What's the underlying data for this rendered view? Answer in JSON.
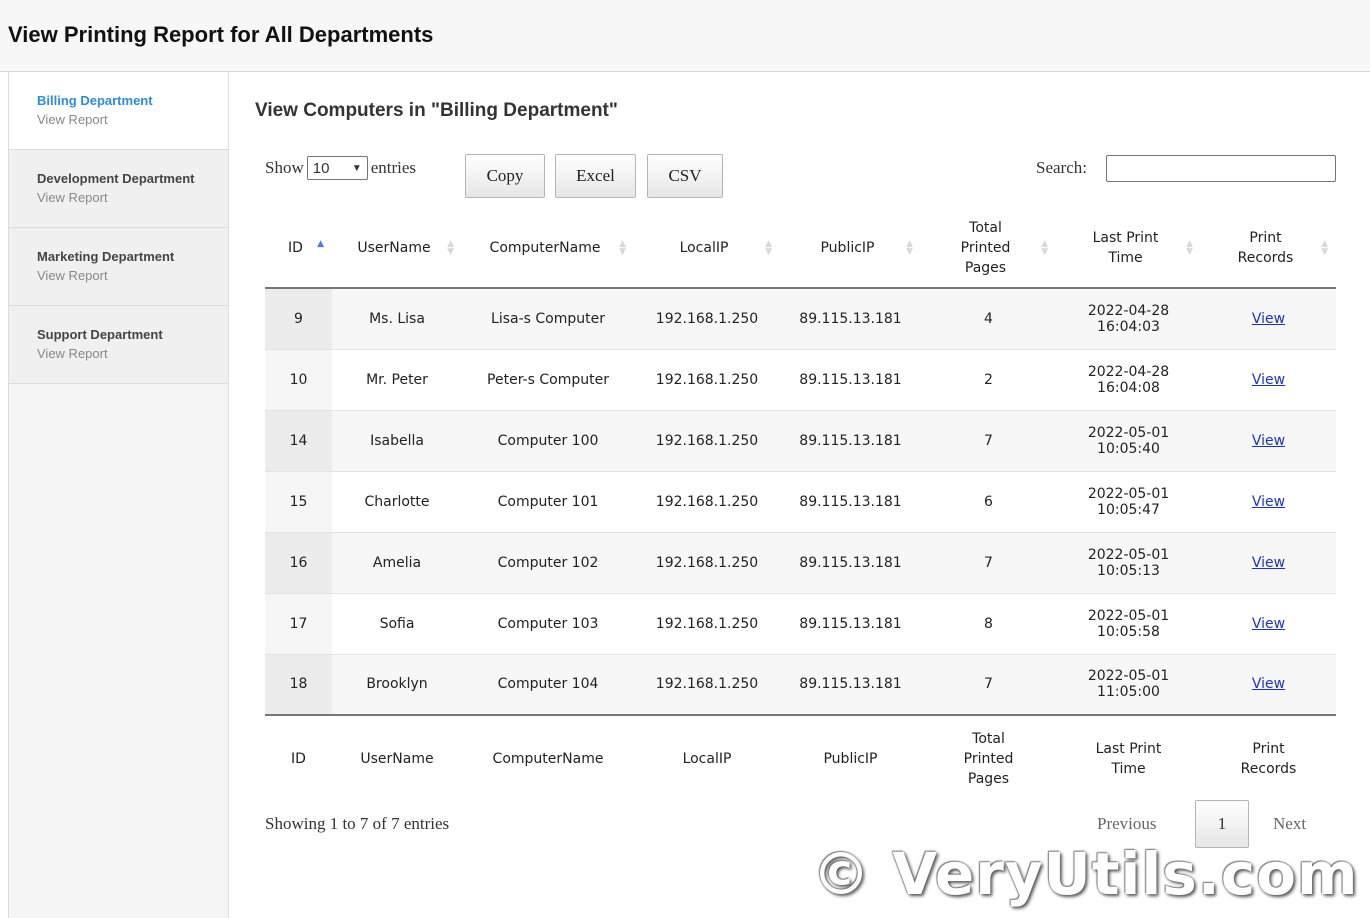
{
  "header": {
    "title": "View Printing Report for All Departments"
  },
  "sidebar": {
    "items": [
      {
        "name": "Billing Department",
        "sub": "View Report",
        "active": true
      },
      {
        "name": "Development Department",
        "sub": "View Report"
      },
      {
        "name": "Marketing Department",
        "sub": "View Report"
      },
      {
        "name": "Support Department",
        "sub": "View Report"
      }
    ]
  },
  "main": {
    "heading": "View Computers in \"Billing Department\"",
    "length": {
      "show": "Show",
      "selected": "10",
      "entries": "entries"
    },
    "buttons": {
      "copy": "Copy",
      "excel": "Excel",
      "csv": "CSV"
    },
    "search": {
      "label": "Search:",
      "value": ""
    }
  },
  "table": {
    "headers": {
      "id": "ID",
      "username": "UserName",
      "computername": "ComputerName",
      "localip": "LocalIP",
      "publicip": "PublicIP",
      "total_line1": "Total",
      "total_line2": "Printed",
      "total_line3": "Pages",
      "last_line1": "Last Print",
      "last_line2": "Time",
      "records_line1": "Print",
      "records_line2": "Records"
    },
    "sorted_column": "ID",
    "sort_direction": "ascending",
    "rows": [
      {
        "id": "9",
        "user": "Ms. Lisa",
        "computer": "Lisa-s Computer",
        "local": "192.168.1.250",
        "public": "89.115.13.181",
        "pages": "4",
        "date": "2022-04-28",
        "time": "16:04:03",
        "link": "View"
      },
      {
        "id": "10",
        "user": "Mr. Peter",
        "computer": "Peter-s Computer",
        "local": "192.168.1.250",
        "public": "89.115.13.181",
        "pages": "2",
        "date": "2022-04-28",
        "time": "16:04:08",
        "link": "View"
      },
      {
        "id": "14",
        "user": "Isabella",
        "computer": "Computer 100",
        "local": "192.168.1.250",
        "public": "89.115.13.181",
        "pages": "7",
        "date": "2022-05-01",
        "time": "10:05:40",
        "link": "View"
      },
      {
        "id": "15",
        "user": "Charlotte",
        "computer": "Computer 101",
        "local": "192.168.1.250",
        "public": "89.115.13.181",
        "pages": "6",
        "date": "2022-05-01",
        "time": "10:05:47",
        "link": "View"
      },
      {
        "id": "16",
        "user": "Amelia",
        "computer": "Computer 102",
        "local": "192.168.1.250",
        "public": "89.115.13.181",
        "pages": "7",
        "date": "2022-05-01",
        "time": "10:05:13",
        "link": "View"
      },
      {
        "id": "17",
        "user": "Sofia",
        "computer": "Computer 103",
        "local": "192.168.1.250",
        "public": "89.115.13.181",
        "pages": "8",
        "date": "2022-05-01",
        "time": "10:05:58",
        "link": "View"
      },
      {
        "id": "18",
        "user": "Brooklyn",
        "computer": "Computer 104",
        "local": "192.168.1.250",
        "public": "89.115.13.181",
        "pages": "7",
        "date": "2022-05-01",
        "time": "11:05:00",
        "link": "View"
      }
    ]
  },
  "footer": {
    "info": "Showing 1 to 7 of 7 entries",
    "previous": "Previous",
    "current_page": "1",
    "next": "Next"
  },
  "watermark": "© VeryUtils.com",
  "colors": {
    "active_link": "#2a8fd8",
    "view_link": "#1a33c8",
    "sort_active": "#4a7bd9"
  },
  "icons": {
    "select": "chevron-down-icon",
    "sort_asc": "sort-asc-icon",
    "sort_both": "sort-both-icon"
  }
}
